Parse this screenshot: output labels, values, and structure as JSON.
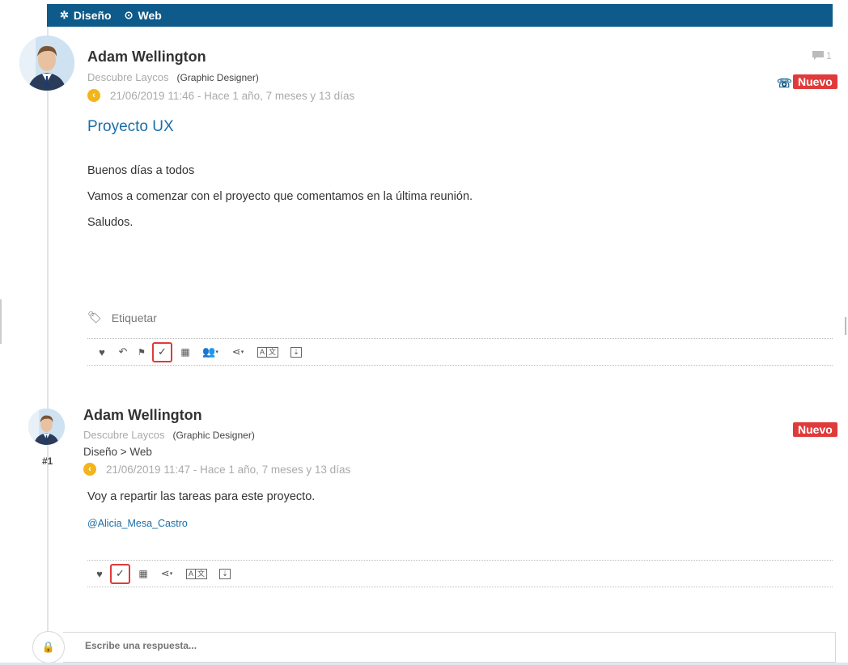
{
  "breadcrumb": {
    "items": [
      {
        "icon": "design-icon",
        "label": "Diseño"
      },
      {
        "icon": "web-icon",
        "label": "Web"
      }
    ]
  },
  "post": {
    "author": "Adam Wellington",
    "company": "Descubre Laycos",
    "role": "(Graphic Designer)",
    "date": "21/06/2019 11:46 - Hace 1 año, 7 meses y 13 días",
    "title": "Proyecto UX",
    "body": [
      "Buenos días a todos",
      "Vamos a comenzar con el proyecto que comentamos en la última reunión.",
      "Saludos."
    ],
    "comment_count": "1",
    "badge": "Nuevo",
    "tag_label": "Etiquetar"
  },
  "reply_item": {
    "author": "Adam Wellington",
    "company": "Descubre Laycos",
    "role": "(Graphic Designer)",
    "path": "Diseño > Web",
    "index": "#1",
    "date": "21/06/2019 11:47 - Hace 1 año, 7 meses y 13 días",
    "body": "Voy a repartir las tareas para este proyecto.",
    "mention": "@Alicia_Mesa_Castro",
    "badge": "Nuevo"
  },
  "reply_box": {
    "placeholder": "Escribe una respuesta..."
  },
  "colors": {
    "brand": "#0e5a8a",
    "badge": "#e03a3a",
    "link": "#1a6ea8",
    "clock": "#f3b51b"
  }
}
